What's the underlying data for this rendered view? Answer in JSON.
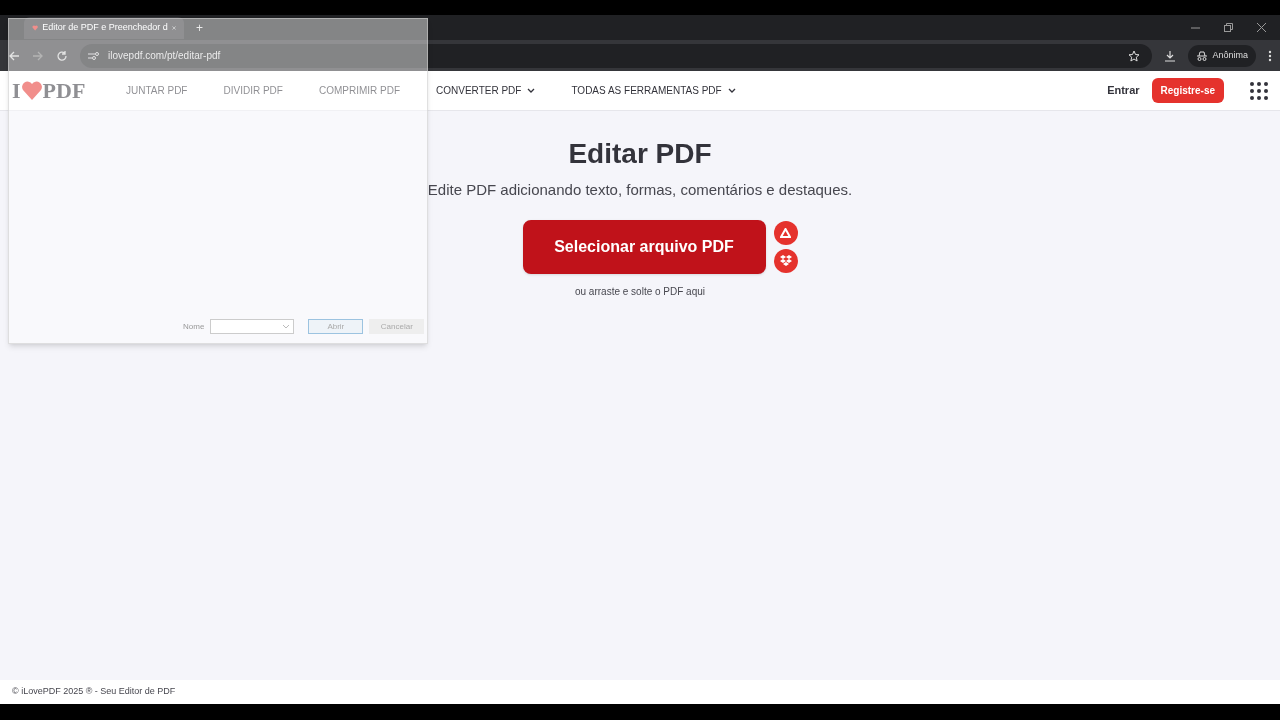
{
  "browser": {
    "tab_title": "Editor de PDF e Preenchedor d",
    "new_tab": "+",
    "url": "ilovepdf.com/pt/editar-pdf",
    "profile": "Anônima"
  },
  "nav": {
    "logo_left": "I",
    "logo_right": "PDF",
    "items": [
      {
        "label": "JUNTAR PDF",
        "dropdown": false
      },
      {
        "label": "DIVIDIR PDF",
        "dropdown": false
      },
      {
        "label": "COMPRIMIR PDF",
        "dropdown": false
      },
      {
        "label": "CONVERTER PDF",
        "dropdown": true
      },
      {
        "label": "TODAS AS FERRAMENTAS PDF",
        "dropdown": true
      }
    ],
    "login": "Entrar",
    "signup": "Registre-se"
  },
  "hero": {
    "title": "Editar PDF",
    "subtitle": "Edite PDF adicionando texto, formas, comentários e destaques.",
    "button": "Selecionar arquivo PDF",
    "hint": "ou arraste e solte o PDF aqui"
  },
  "dialog": {
    "name_label": "Nome",
    "open_button": "Abrir",
    "cancel_button": "Cancelar"
  },
  "footer": "© iLovePDF 2025 ® - Seu Editor de PDF"
}
